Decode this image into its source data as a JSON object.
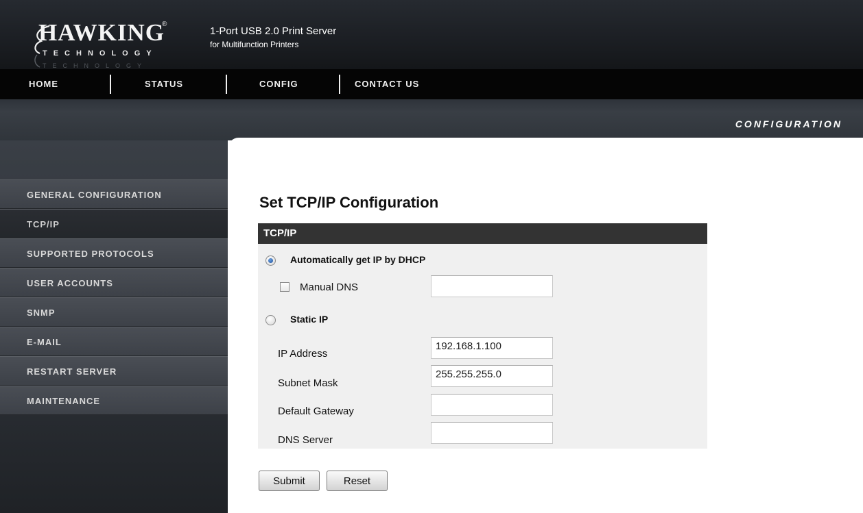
{
  "brand": {
    "word": "HAWKING",
    "registered": "®",
    "sub": "TECHNOLOGY"
  },
  "product": {
    "line1": "1-Port USB 2.0 Print Server",
    "line2": "for Multifunction Printers"
  },
  "nav": {
    "items": [
      "HOME",
      "STATUS",
      "CONFIG",
      "CONTACT US"
    ]
  },
  "section_title": "CONFIGURATION",
  "sidebar": {
    "items": [
      {
        "label": "GENERAL CONFIGURATION"
      },
      {
        "label": "TCP/IP"
      },
      {
        "label": "SUPPORTED PROTOCOLS"
      },
      {
        "label": "USER ACCOUNTS"
      },
      {
        "label": "SNMP"
      },
      {
        "label": "E-MAIL"
      },
      {
        "label": "RESTART SERVER"
      },
      {
        "label": "MAINTENANCE"
      }
    ]
  },
  "form": {
    "title": "Set TCP/IP Configuration",
    "header": "TCP/IP",
    "dhcp_label": "Automatically get IP by DHCP",
    "manual_dns_label": "Manual DNS",
    "manual_dns_value": "",
    "static_label": "Static IP",
    "ip_label": "IP Address",
    "ip_value": "192.168.1.100",
    "mask_label": "Subnet Mask",
    "mask_value": "255.255.255.0",
    "gateway_label": "Default Gateway",
    "gateway_value": "",
    "dns_label": "DNS Server",
    "dns_value": "",
    "selected_mode": "dhcp",
    "manual_dns_checked": false
  },
  "buttons": {
    "submit": "Submit",
    "reset": "Reset"
  },
  "colors": {
    "header_bg": "#1c1f24",
    "nav_bg": "#050505",
    "form_head_bg": "#333333",
    "form_bg": "#f0f0f0",
    "sidebar_item_bg": "#44484f",
    "radio_dot": "#1d4e9a"
  }
}
